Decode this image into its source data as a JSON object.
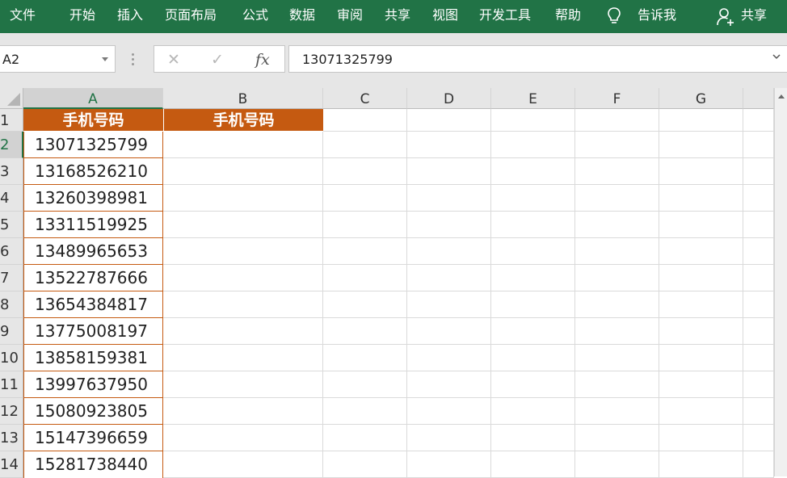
{
  "ribbon": {
    "tabs": [
      "文件",
      "开始",
      "插入",
      "页面布局",
      "公式",
      "数据",
      "审阅",
      "共享",
      "视图",
      "开发工具",
      "帮助"
    ],
    "tell_me": "告诉我",
    "share": "共享",
    "bg_color": "#217346"
  },
  "formula_bar": {
    "name_box": "A2",
    "cancel_icon": "✕",
    "enter_icon": "✓",
    "fx_label": "fx",
    "formula_value": "13071325799"
  },
  "sheet": {
    "columns": [
      "A",
      "B",
      "C",
      "D",
      "E",
      "F",
      "G"
    ],
    "rows": [
      "1",
      "2",
      "3",
      "4",
      "5",
      "6",
      "7",
      "8",
      "9",
      "10",
      "11",
      "12",
      "13",
      "14"
    ],
    "header_row": {
      "A": "手机号码",
      "B": "手机号码"
    },
    "header_fill": "#c55a11",
    "phone_numbers": [
      "13071325799",
      "13168526210",
      "13260398981",
      "13311519925",
      "13489965653",
      "13522787666",
      "13654384817",
      "13775008197",
      "13858159381",
      "13997637950",
      "15080923805",
      "15147396659",
      "15281738440"
    ],
    "selected_cell": "A2"
  }
}
